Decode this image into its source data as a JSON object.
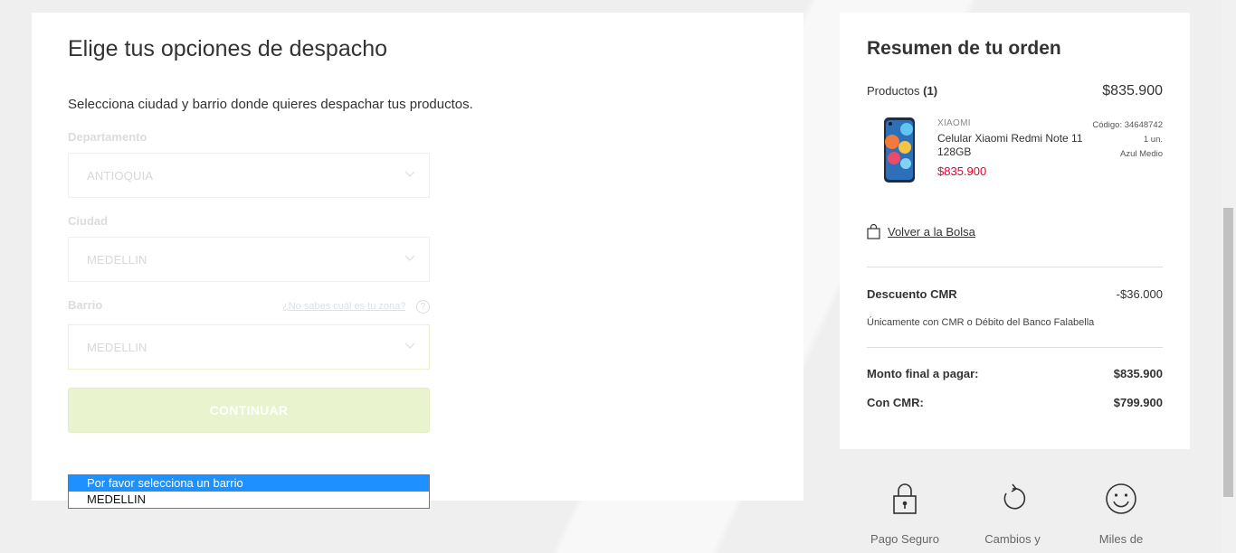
{
  "shipping": {
    "title": "Elige tus opciones de despacho",
    "subtitle": "Selecciona ciudad y barrio donde quieres despachar tus productos.",
    "department_label": "Departamento",
    "department_value": "ANTIOQUIA",
    "city_label": "Ciudad",
    "city_value": "MEDELLIN",
    "neighborhood_label": "Barrio",
    "neighborhood_value": "MEDELLIN",
    "help_link": "¿No sabes cuál es tu zona?",
    "help_icon_glyph": "?",
    "continue_label": "CONTINUAR",
    "dropdown_options": [
      "Por favor selecciona un barrio",
      "MEDELLIN"
    ]
  },
  "summary": {
    "title": "Resumen de tu orden",
    "products_label": "Productos",
    "products_count": "(1)",
    "products_total": "$835.900",
    "product": {
      "brand": "XIAOMI",
      "name": "Celular Xiaomi Redmi Note 11 128GB",
      "price": "$835.900",
      "code": "Código: 34648742",
      "quantity": "1 un.",
      "color": "Azul Medio"
    },
    "back_link": "Volver a la Bolsa",
    "discount_label": "Descuento CMR",
    "discount_value": "-$36.000",
    "discount_note": "Únicamente con CMR o Débito del Banco Falabella",
    "final_label": "Monto final a pagar:",
    "final_value": "$835.900",
    "cmr_label": "Con CMR:",
    "cmr_value": "$799.900"
  },
  "badges": [
    {
      "icon": "lock-icon",
      "label": "Pago Seguro"
    },
    {
      "icon": "refresh-icon",
      "label": "Cambios y"
    },
    {
      "icon": "smiley-icon",
      "label": "Miles de"
    }
  ],
  "colors": {
    "accent_green_disabled": "#e9f3cd",
    "price_red": "#e4002b",
    "dropdown_highlight": "#1e90ff"
  }
}
